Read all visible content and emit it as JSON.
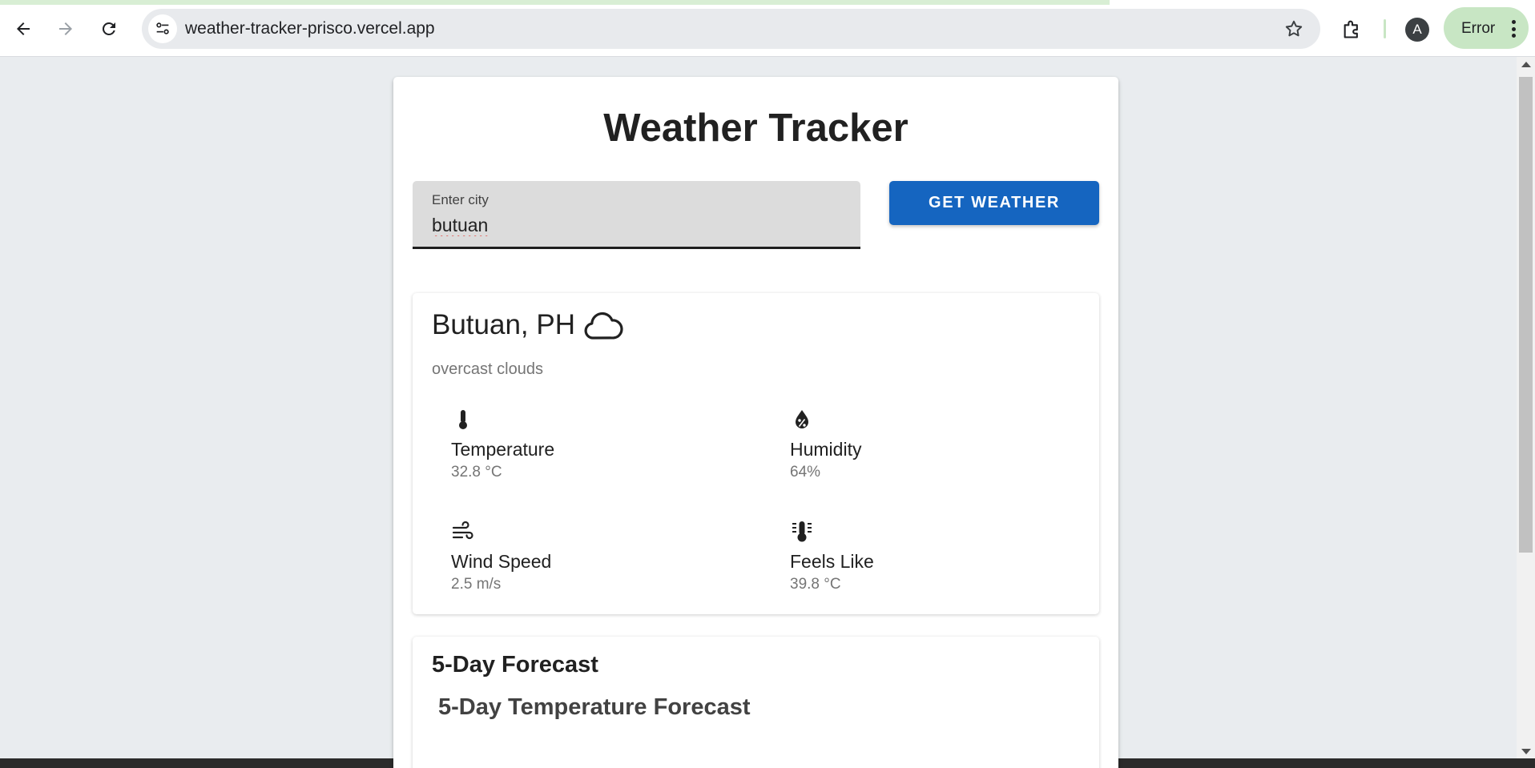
{
  "browser": {
    "url": "weather-tracker-prisco.vercel.app",
    "profile_initial": "A",
    "status_chip": "Error",
    "icons": [
      "back-arrow-icon",
      "forward-arrow-icon",
      "reload-icon",
      "site-info-icon",
      "star-icon",
      "extensions-icon",
      "more-vert-icon"
    ]
  },
  "app": {
    "title": "Weather Tracker",
    "search": {
      "label": "Enter city",
      "value": "butuan"
    },
    "button_label": "GET WEATHER"
  },
  "current": {
    "location": "Butuan, PH",
    "condition_icon": "cloud-icon",
    "description": "overcast clouds",
    "stats": [
      {
        "icon": "thermometer-icon",
        "label": "Temperature",
        "value": "32.8 °C"
      },
      {
        "icon": "humidity-drop-icon",
        "label": "Humidity",
        "value": "64%"
      },
      {
        "icon": "wind-icon",
        "label": "Wind Speed",
        "value": "2.5 m/s"
      },
      {
        "icon": "feels-like-thermometer-icon",
        "label": "Feels Like",
        "value": "39.8 °C"
      }
    ]
  },
  "forecast": {
    "title": "5-Day Forecast",
    "chart_title": "5-Day Temperature Forecast"
  },
  "colors": {
    "accent": "#1565c0",
    "page_bg": "#e9ecef",
    "error_chip": "#c8e6c4"
  }
}
